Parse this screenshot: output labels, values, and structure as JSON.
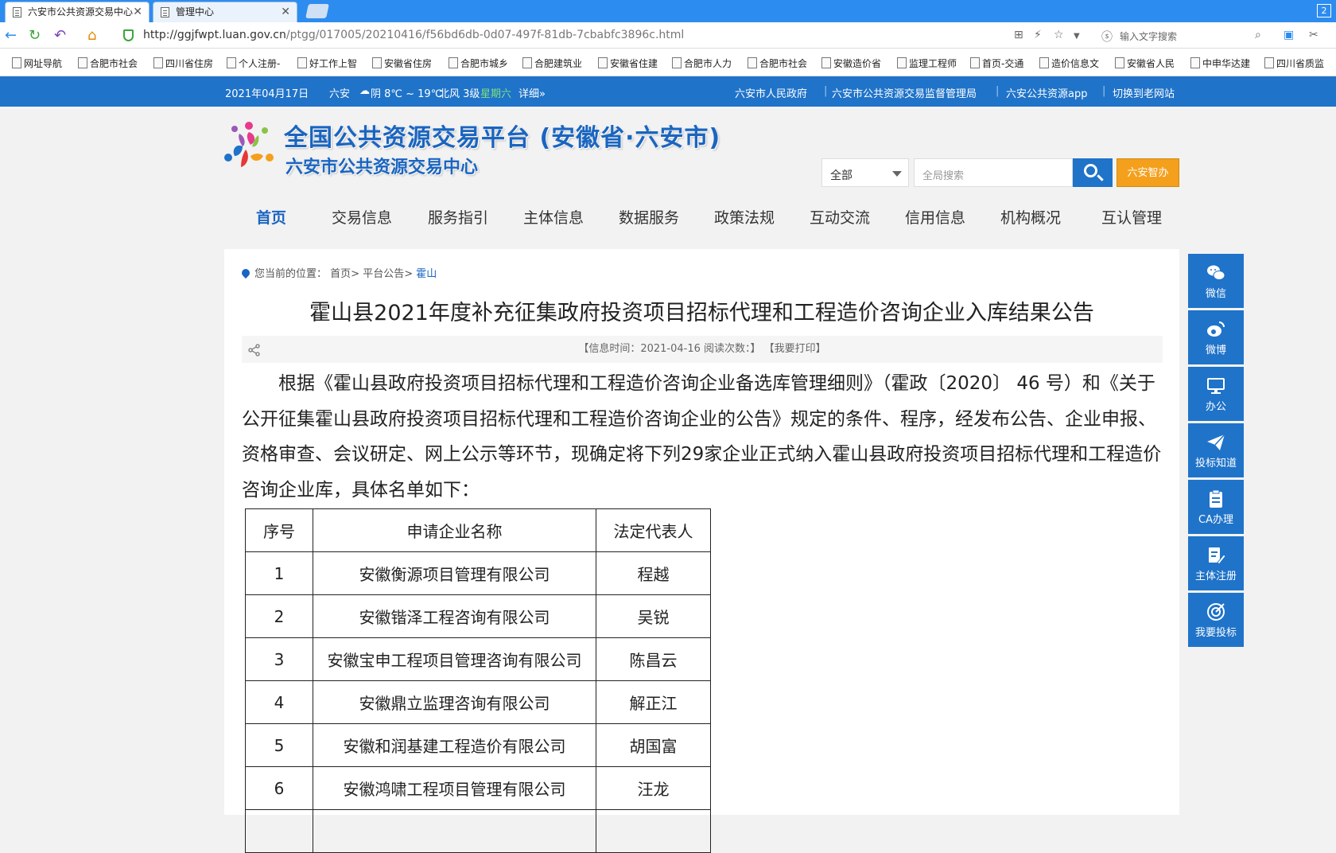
{
  "browser": {
    "tabs": [
      {
        "title": "六安市公共资源交易中心",
        "active": true
      },
      {
        "title": "管理中心",
        "active": false
      }
    ],
    "tab_count": "2",
    "url_host": "http://ggjfwpt.luan.gov.cn",
    "url_path": "/ptgg/017005/20210416/f56bd6db-0d07-497f-81db-7cbabfc3896c.html",
    "search_placeholder": "输入文字搜索",
    "bookmarks": [
      "网址导航",
      "合肥市社会",
      "四川省住房",
      "个人注册-",
      "好工作上智",
      "安徽省住房",
      "合肥市城乡",
      "合肥建筑业",
      "安徽省住建",
      "合肥市人力",
      "合肥市社会",
      "安徽造价省",
      "监理工程师",
      "首页-交通",
      "造价信息文",
      "安徽省人民",
      "中申华达建",
      "四川省质监"
    ]
  },
  "topbar": {
    "date": "2021年04月17日",
    "city": "六安",
    "weather": "阴 8℃ ~ 19℃",
    "wind": "北风 3级",
    "weekday": "星期六",
    "detail": "详细»",
    "links": [
      "六安市人民政府",
      "六安市公共资源交易监督管理局",
      "六安公共资源app",
      "切换到老网站"
    ]
  },
  "header": {
    "title_main": "全国公共资源交易平台 (安徽省·六安市)",
    "title_sub": "六安市公共资源交易中心",
    "search_scope": "全部",
    "search_placeholder": "全局搜索",
    "orange_button": "六安智办"
  },
  "nav": [
    "首页",
    "交易信息",
    "服务指引",
    "主体信息",
    "数据服务",
    "政策法规",
    "互动交流",
    "信用信息",
    "机构概况",
    "互认管理"
  ],
  "breadcrumb": {
    "prefix": "您当前的位置：",
    "home": "首页>",
    "section": "平台公告>",
    "current": "霍山"
  },
  "article": {
    "title": "霍山县2021年度补充征集政府投资项目招标代理和工程造价咨询企业入库结果公告",
    "meta": "【信息时间：2021-04-16   阅读次数：】 【我要打印】",
    "paragraph": "根据《霍山县政府投资项目招标代理和工程造价咨询企业备选库管理细则》（霍政〔2020〕 46 号）和《关于公开征集霍山县政府投资项目招标代理和工程造价咨询企业的公告》规定的条件、程序，经发布公告、企业申报、资格审查、会议研定、网上公示等环节，现确定将下列29家企业正式纳入霍山县政府投资项目招标代理和工程造价咨询企业库，具体名单如下：",
    "table_headers": [
      "序号",
      "申请企业名称",
      "法定代表人"
    ],
    "rows": [
      [
        "1",
        "安徽衡源项目管理有限公司",
        "程越"
      ],
      [
        "2",
        "安徽锴泽工程咨询有限公司",
        "吴锐"
      ],
      [
        "3",
        "安徽宝申工程项目管理咨询有限公司",
        "陈昌云"
      ],
      [
        "4",
        "安徽鼎立监理咨询有限公司",
        "解正江"
      ],
      [
        "5",
        "安徽和润基建工程造价有限公司",
        "胡国富"
      ],
      [
        "6",
        "安徽鸿啸工程项目管理有限公司",
        "汪龙"
      ],
      [
        "",
        "",
        ""
      ]
    ]
  },
  "float_menu": [
    "微信",
    "微博",
    "办公",
    "投标知道",
    "CA办理",
    "主体注册",
    "我要投标"
  ],
  "colors": {
    "brand_blue": "#1f73c9",
    "accent_orange": "#f4a01c"
  }
}
